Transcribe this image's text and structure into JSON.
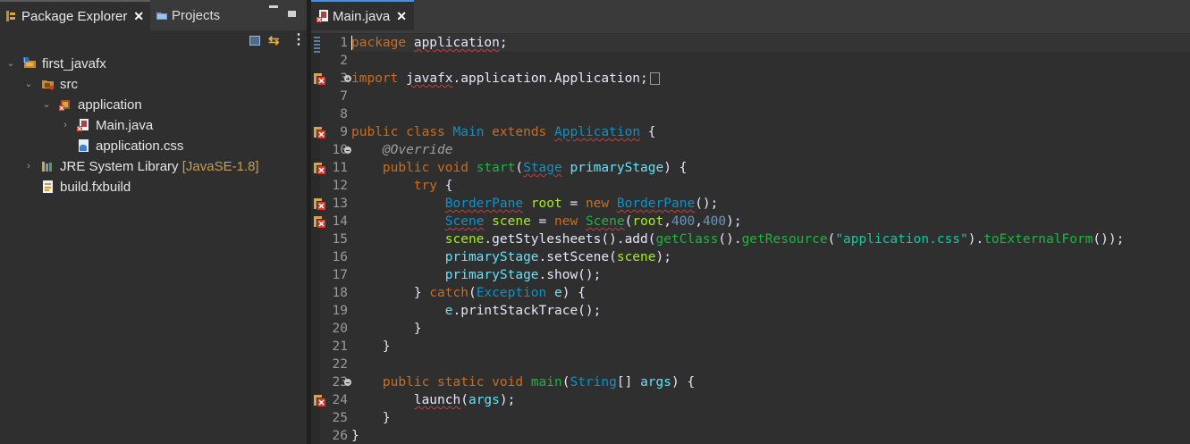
{
  "left_pane": {
    "tabs": [
      {
        "label": "Package Explorer",
        "active": true,
        "closable": true
      },
      {
        "label": "Projects",
        "active": false
      }
    ],
    "tree": [
      {
        "label": "first_javafx",
        "icon": "java-project-icon",
        "expanded": true
      },
      {
        "label": "src",
        "icon": "source-folder-icon",
        "expanded": true
      },
      {
        "label": "application",
        "icon": "package-icon",
        "expanded": true
      },
      {
        "label": "Main.java",
        "icon": "java-file-error-icon",
        "expanded": false
      },
      {
        "label": "application.css",
        "icon": "css-file-icon"
      },
      {
        "label": "JRE System Library",
        "decoration": "[JavaSE-1.8]",
        "icon": "library-icon",
        "expanded": false
      },
      {
        "label": "build.fxbuild",
        "icon": "fxbuild-file-icon"
      }
    ]
  },
  "editor": {
    "tab": {
      "label": "Main.java",
      "closable": true
    },
    "line_numbers": [
      "1",
      "2",
      "3",
      "7",
      "8",
      "9",
      "10",
      "11",
      "12",
      "13",
      "14",
      "15",
      "16",
      "17",
      "18",
      "19",
      "20",
      "21",
      "22",
      "23",
      "24",
      "25",
      "26"
    ],
    "colors": {
      "keyword": "#cc6c1d",
      "type": "#1290c3",
      "method": "#1eb540",
      "string": "#17c6a3",
      "number": "#6897bb",
      "error": "#e03232"
    },
    "lines": [
      [
        [
          "k",
          "package"
        ],
        [
          "p",
          " "
        ],
        [
          "p",
          "application",
          "w"
        ],
        [
          "p",
          ";"
        ]
      ],
      [],
      [
        [
          "k",
          "import"
        ],
        [
          "p",
          " "
        ],
        [
          "p",
          "javafx",
          "w"
        ],
        [
          "p",
          ".application.Application;"
        ]
      ],
      [],
      [],
      [
        [
          "k",
          "public"
        ],
        [
          "p",
          " "
        ],
        [
          "k",
          "class"
        ],
        [
          "p",
          " "
        ],
        [
          "t",
          "Main"
        ],
        [
          "p",
          " "
        ],
        [
          "k",
          "extends"
        ],
        [
          "p",
          " "
        ],
        [
          "t",
          "Application",
          "w"
        ],
        [
          "p",
          " {"
        ]
      ],
      [
        [
          "p",
          "    "
        ],
        [
          "a",
          "@Override"
        ]
      ],
      [
        [
          "p",
          "    "
        ],
        [
          "k",
          "public"
        ],
        [
          "p",
          " "
        ],
        [
          "k",
          "void"
        ],
        [
          "p",
          " "
        ],
        [
          "m",
          "start"
        ],
        [
          "p",
          "("
        ],
        [
          "t",
          "Stage",
          "w"
        ],
        [
          "p",
          " "
        ],
        [
          "v",
          "primaryStage"
        ],
        [
          "p",
          ") {"
        ]
      ],
      [
        [
          "p",
          "        "
        ],
        [
          "k",
          "try"
        ],
        [
          "p",
          " {"
        ]
      ],
      [
        [
          "p",
          "            "
        ],
        [
          "t",
          "BorderPane",
          "w"
        ],
        [
          "p",
          " "
        ],
        [
          "f",
          "root"
        ],
        [
          "p",
          " = "
        ],
        [
          "k",
          "new"
        ],
        [
          "p",
          " "
        ],
        [
          "t",
          "BorderPane",
          "w"
        ],
        [
          "p",
          "();"
        ]
      ],
      [
        [
          "p",
          "            "
        ],
        [
          "t",
          "Scene",
          "w"
        ],
        [
          "p",
          " "
        ],
        [
          "f",
          "scene"
        ],
        [
          "p",
          " = "
        ],
        [
          "k",
          "new"
        ],
        [
          "p",
          " "
        ],
        [
          "m",
          "Scene",
          "w"
        ],
        [
          "p",
          "("
        ],
        [
          "f",
          "root"
        ],
        [
          "p",
          ","
        ],
        [
          "n",
          "400"
        ],
        [
          "p",
          ","
        ],
        [
          "n",
          "400"
        ],
        [
          "p",
          ");"
        ]
      ],
      [
        [
          "p",
          "            "
        ],
        [
          "f",
          "scene"
        ],
        [
          "p",
          "."
        ],
        [
          "p",
          "getStylesheets"
        ],
        [
          "p",
          "()."
        ],
        [
          "p",
          "add"
        ],
        [
          "p",
          "("
        ],
        [
          "m",
          "getClass"
        ],
        [
          "p",
          "()."
        ],
        [
          "m",
          "getResource"
        ],
        [
          "p",
          "("
        ],
        [
          "s",
          "\"application.css\""
        ],
        [
          "p",
          ")."
        ],
        [
          "m",
          "toExternalForm"
        ],
        [
          "p",
          "());"
        ]
      ],
      [
        [
          "p",
          "            "
        ],
        [
          "v",
          "primaryStage"
        ],
        [
          "p",
          ".setScene("
        ],
        [
          "f",
          "scene"
        ],
        [
          "p",
          ");"
        ]
      ],
      [
        [
          "p",
          "            "
        ],
        [
          "v",
          "primaryStage"
        ],
        [
          "p",
          ".show();"
        ]
      ],
      [
        [
          "p",
          "        } "
        ],
        [
          "k",
          "catch"
        ],
        [
          "p",
          "("
        ],
        [
          "t",
          "Exception"
        ],
        [
          "p",
          " "
        ],
        [
          "v",
          "e"
        ],
        [
          "p",
          ") {"
        ]
      ],
      [
        [
          "p",
          "            "
        ],
        [
          "v",
          "e"
        ],
        [
          "p",
          ".printStackTrace();"
        ]
      ],
      [
        [
          "p",
          "        }"
        ]
      ],
      [
        [
          "p",
          "    }"
        ]
      ],
      [],
      [
        [
          "p",
          "    "
        ],
        [
          "k",
          "public"
        ],
        [
          "p",
          " "
        ],
        [
          "k",
          "static"
        ],
        [
          "p",
          " "
        ],
        [
          "k",
          "void"
        ],
        [
          "p",
          " "
        ],
        [
          "m",
          "main"
        ],
        [
          "p",
          "("
        ],
        [
          "t",
          "String"
        ],
        [
          "p",
          "[] "
        ],
        [
          "v",
          "args"
        ],
        [
          "p",
          ") {"
        ]
      ],
      [
        [
          "p",
          "        "
        ],
        [
          "p",
          "launch",
          "w"
        ],
        [
          "p",
          "("
        ],
        [
          "v",
          "args"
        ],
        [
          "p",
          ");"
        ]
      ],
      [
        [
          "p",
          "    }"
        ]
      ],
      [
        [
          "p",
          "}"
        ]
      ]
    ]
  }
}
